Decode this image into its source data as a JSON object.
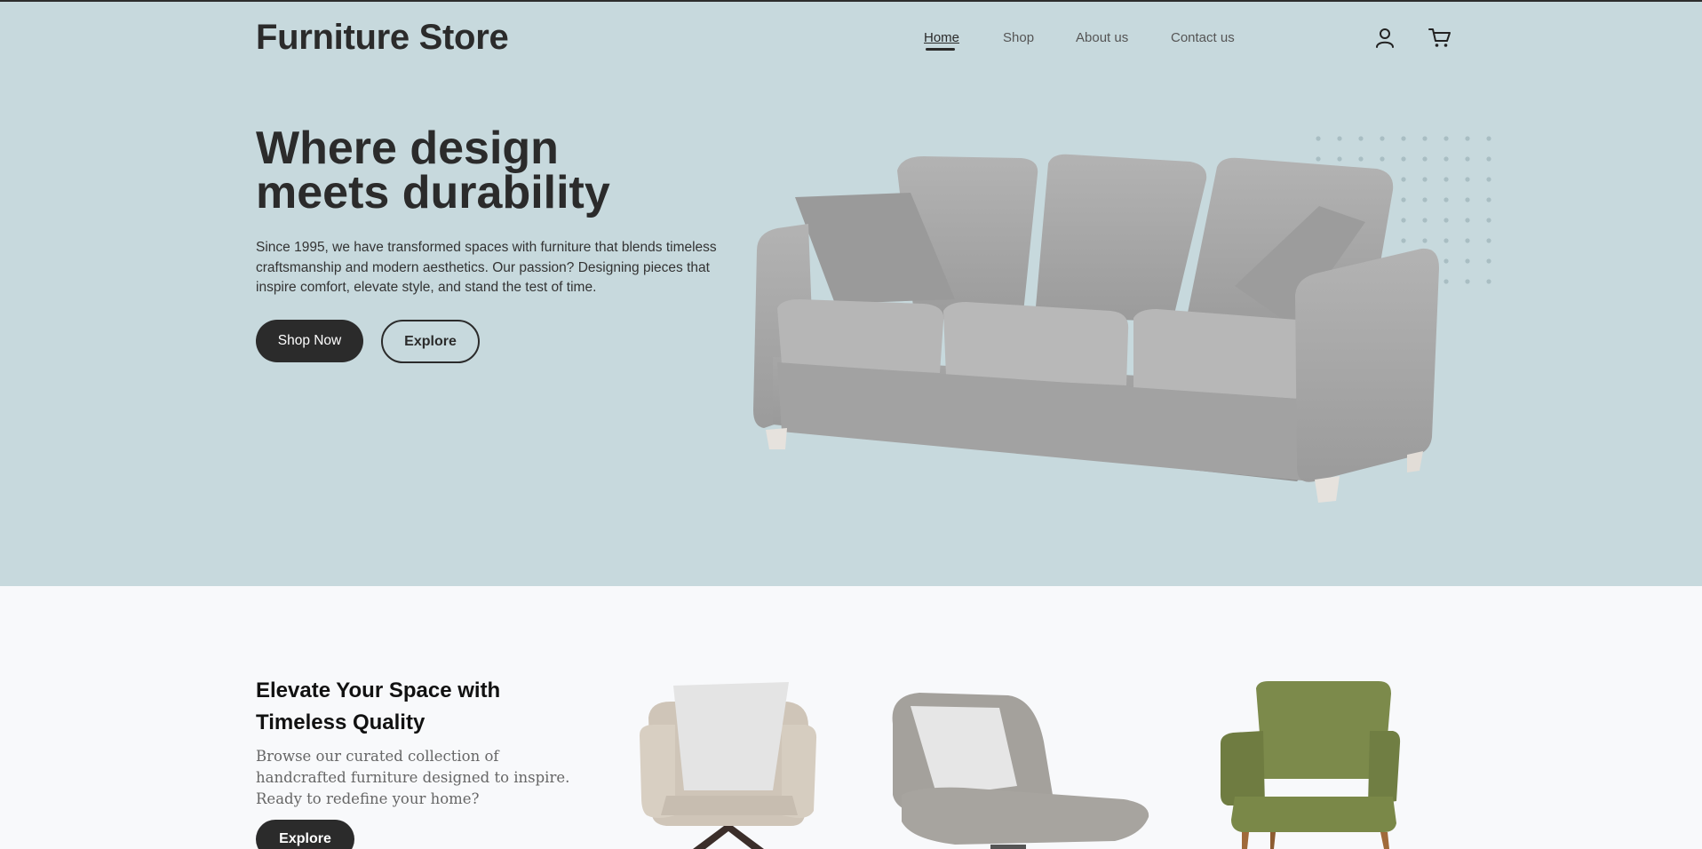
{
  "brand": {
    "name": "Furniture Store"
  },
  "nav": {
    "items": [
      {
        "label": "Home",
        "active": true
      },
      {
        "label": "Shop",
        "active": false
      },
      {
        "label": "About us",
        "active": false
      },
      {
        "label": "Contact us",
        "active": false
      }
    ],
    "icons": [
      "user-icon",
      "cart-icon"
    ]
  },
  "hero": {
    "headline_line1": "Where design",
    "headline_line2": "meets durability",
    "lead": "Since 1995, we have transformed spaces with furniture that blends timeless craftsmanship and modern aesthetics. Our passion? Designing pieces that inspire comfort, elevate style, and stand the test of time.",
    "primary_cta": "Shop Now",
    "secondary_cta": "Explore"
  },
  "collection": {
    "title_line1": "Elevate Your Space with",
    "title_line2": "Timeless Quality",
    "text": "Browse our curated collection of handcrafted furniture designed to inspire. Ready to redefine your home?",
    "cta": "Explore"
  },
  "colors": {
    "hero_bg": "#c7d9dd",
    "dark": "#2b2b2b",
    "page_bg": "#f8f9fb",
    "sofa_fabric": "#a9a9a9",
    "chair_green": "#7a8a4a"
  }
}
